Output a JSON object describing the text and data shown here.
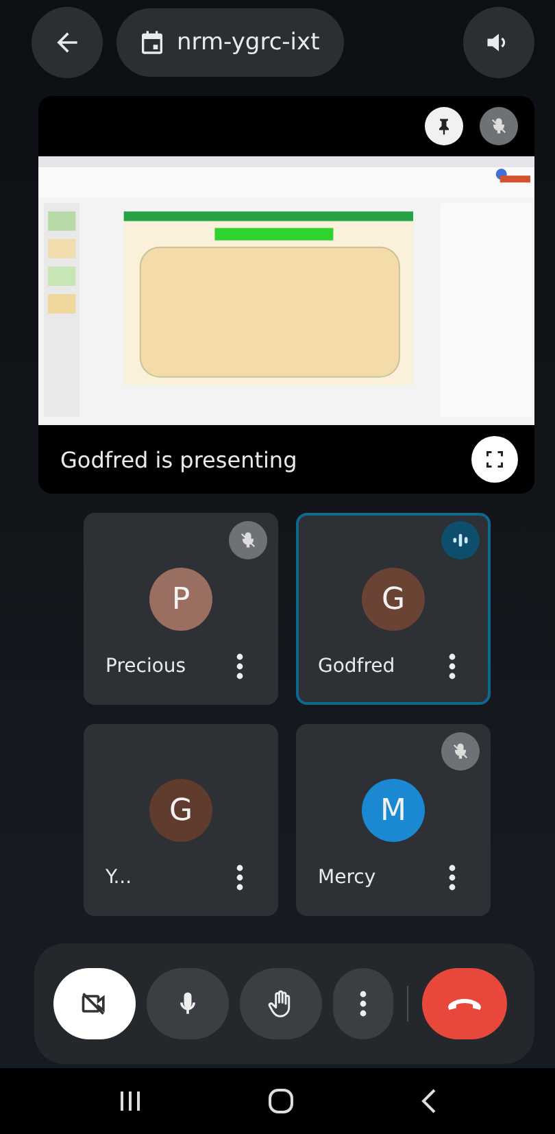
{
  "top_bar": {
    "meeting_code": "nrm-ygrc-ixt"
  },
  "presentation": {
    "pinned": true,
    "muted": true,
    "caption": "Godfred is presenting"
  },
  "participants": [
    {
      "name": "Precious",
      "initial": "P",
      "color": "#9a6e60",
      "muted": true,
      "speaking": false
    },
    {
      "name": "Godfred",
      "initial": "G",
      "color": "#6a4334",
      "muted": false,
      "speaking": true
    },
    {
      "name": "Y...",
      "initial": "G",
      "color": "#603c2f",
      "muted": false,
      "speaking": false
    },
    {
      "name": "Mercy",
      "initial": "M",
      "color": "#1b89d2",
      "muted": true,
      "speaking": false
    }
  ],
  "controls": [
    {
      "kind": "camera",
      "on": false
    },
    {
      "kind": "mic",
      "on": true
    },
    {
      "kind": "hand"
    },
    {
      "kind": "more"
    },
    {
      "kind": "end"
    }
  ]
}
